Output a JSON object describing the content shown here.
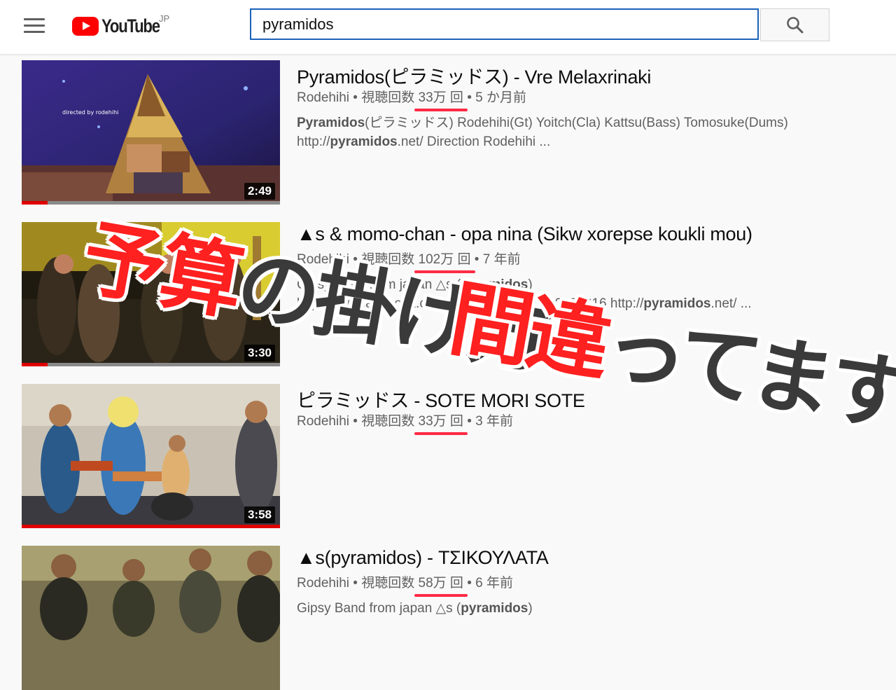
{
  "header": {
    "logo_text": "YouTube",
    "region": "JP",
    "search_value": "pyramidos"
  },
  "results": [
    {
      "title": "Pyramidos(ピラミッドス) - Vre Melaxrinaki",
      "channel": "Rodehihi",
      "views": "33万 回",
      "views_prefix": "視聴回数",
      "age": "5 か月前",
      "desc_line1_bold": "Pyramidos",
      "desc_line1_rest": "(ピラミッドス) Rodehihi(Gt) Yoitch(Cla) Kattsu(Bass) Tomosuke(Dums)",
      "desc_line2_pre": "http://",
      "desc_line2_bold": "pyramidos",
      "desc_line2_rest": ".net/ Direction Rodehihi ...",
      "thumb_caption": "directed by rodehihi",
      "duration": "2:49",
      "watched_fraction": 0.1
    },
    {
      "title": "▲s & momo-chan - opa nina (Sikw xorepse koukli mou)",
      "channel": "Rodehihi",
      "views": "102万 回",
      "views_prefix": "視聴回数",
      "age": "7 年前",
      "desc_line1_pre": "Gipsy Band from japan △s (",
      "desc_line1_bold": "pyramidos",
      "desc_line1_rest": ")",
      "desc_line2_pre": "http://www.facebook.com/pages/     /166016380123616 http://",
      "desc_line2_bold": "pyramidos",
      "desc_line2_rest": ".net/ ...",
      "duration": "3:30",
      "watched_fraction": 0.1
    },
    {
      "title": "ピラミッドス - SOTE MORI SOTE",
      "channel": "Rodehihi",
      "views": "33万 回",
      "views_prefix": "視聴回数",
      "age": "3 年前",
      "duration": "3:58",
      "watched_fraction": 1.0
    },
    {
      "title": "▲s(pyramidos) - ΤΣΙΚΟΥΛΑΤΑ",
      "channel": "Rodehihi",
      "views": "58万 回",
      "views_prefix": "視聴回数",
      "age": "6 年前",
      "desc_line1_pre": "Gipsy Band from japan △s (",
      "desc_line1_bold": "pyramidos",
      "desc_line1_rest": ")"
    }
  ],
  "overlay": {
    "line1_red": "予算",
    "line1_dark": "の掛け方",
    "line2_red": "間違",
    "line2_dark": "ってます"
  },
  "colors": {
    "accent_red": "#ff0000",
    "search_border": "#1c62b9",
    "underline": "#ff2a45"
  }
}
